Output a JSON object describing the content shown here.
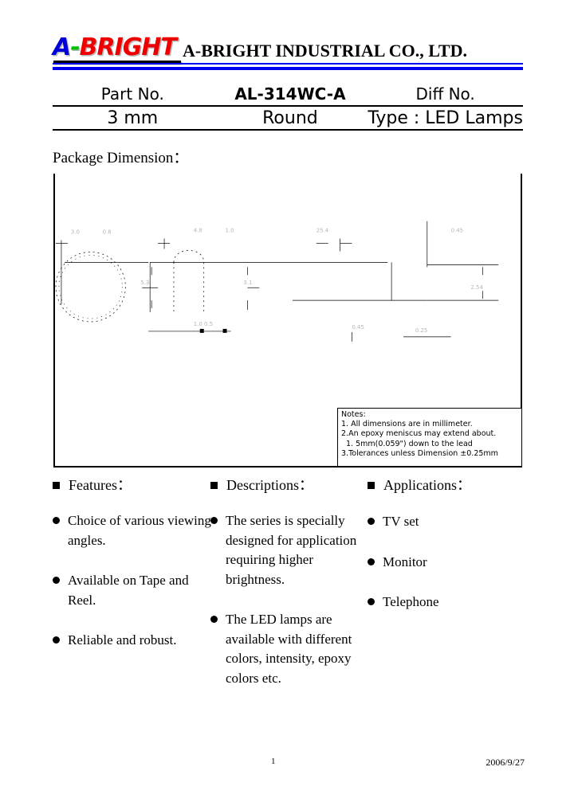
{
  "header": {
    "logo": {
      "letter_a": "A",
      "dash": "-",
      "bright": "BRIGHT"
    },
    "company_name": "A-BRIGHT INDUSTRIAL CO., LTD."
  },
  "part_table": {
    "row1": {
      "part_no_label": "Part No.",
      "part_no_value": "AL-314WC-A",
      "diff_no_label": "Diff No."
    },
    "row2": {
      "size": "3 mm",
      "shape": "Round",
      "type": "Type : LED Lamps"
    }
  },
  "package_dimension": {
    "title": "Package Dimension：",
    "notes": {
      "heading": "Notes:",
      "line1": "1. All dimensions are in millimeter.",
      "line2": "2.An epoxy meniscus may extend about.",
      "line3": "1. 5mm(0.059\") down to the lead",
      "line4": "3.Tolerances unless Dimension ±0.25mm"
    }
  },
  "columns": {
    "features": {
      "heading": "Features：",
      "items": [
        "Choice of various viewing angles.",
        "Available on Tape and Reel.",
        "Reliable and robust."
      ]
    },
    "descriptions": {
      "heading": "Descriptions：",
      "items": [
        "The series is specially designed for application requiring higher brightness.",
        "The LED lamps are available with different colors, intensity, epoxy colors etc."
      ]
    },
    "applications": {
      "heading": "Applications：",
      "items": [
        "TV set",
        "Monitor",
        "Telephone"
      ]
    }
  },
  "footer": {
    "page_number": "1",
    "date": "2006/9/27"
  }
}
